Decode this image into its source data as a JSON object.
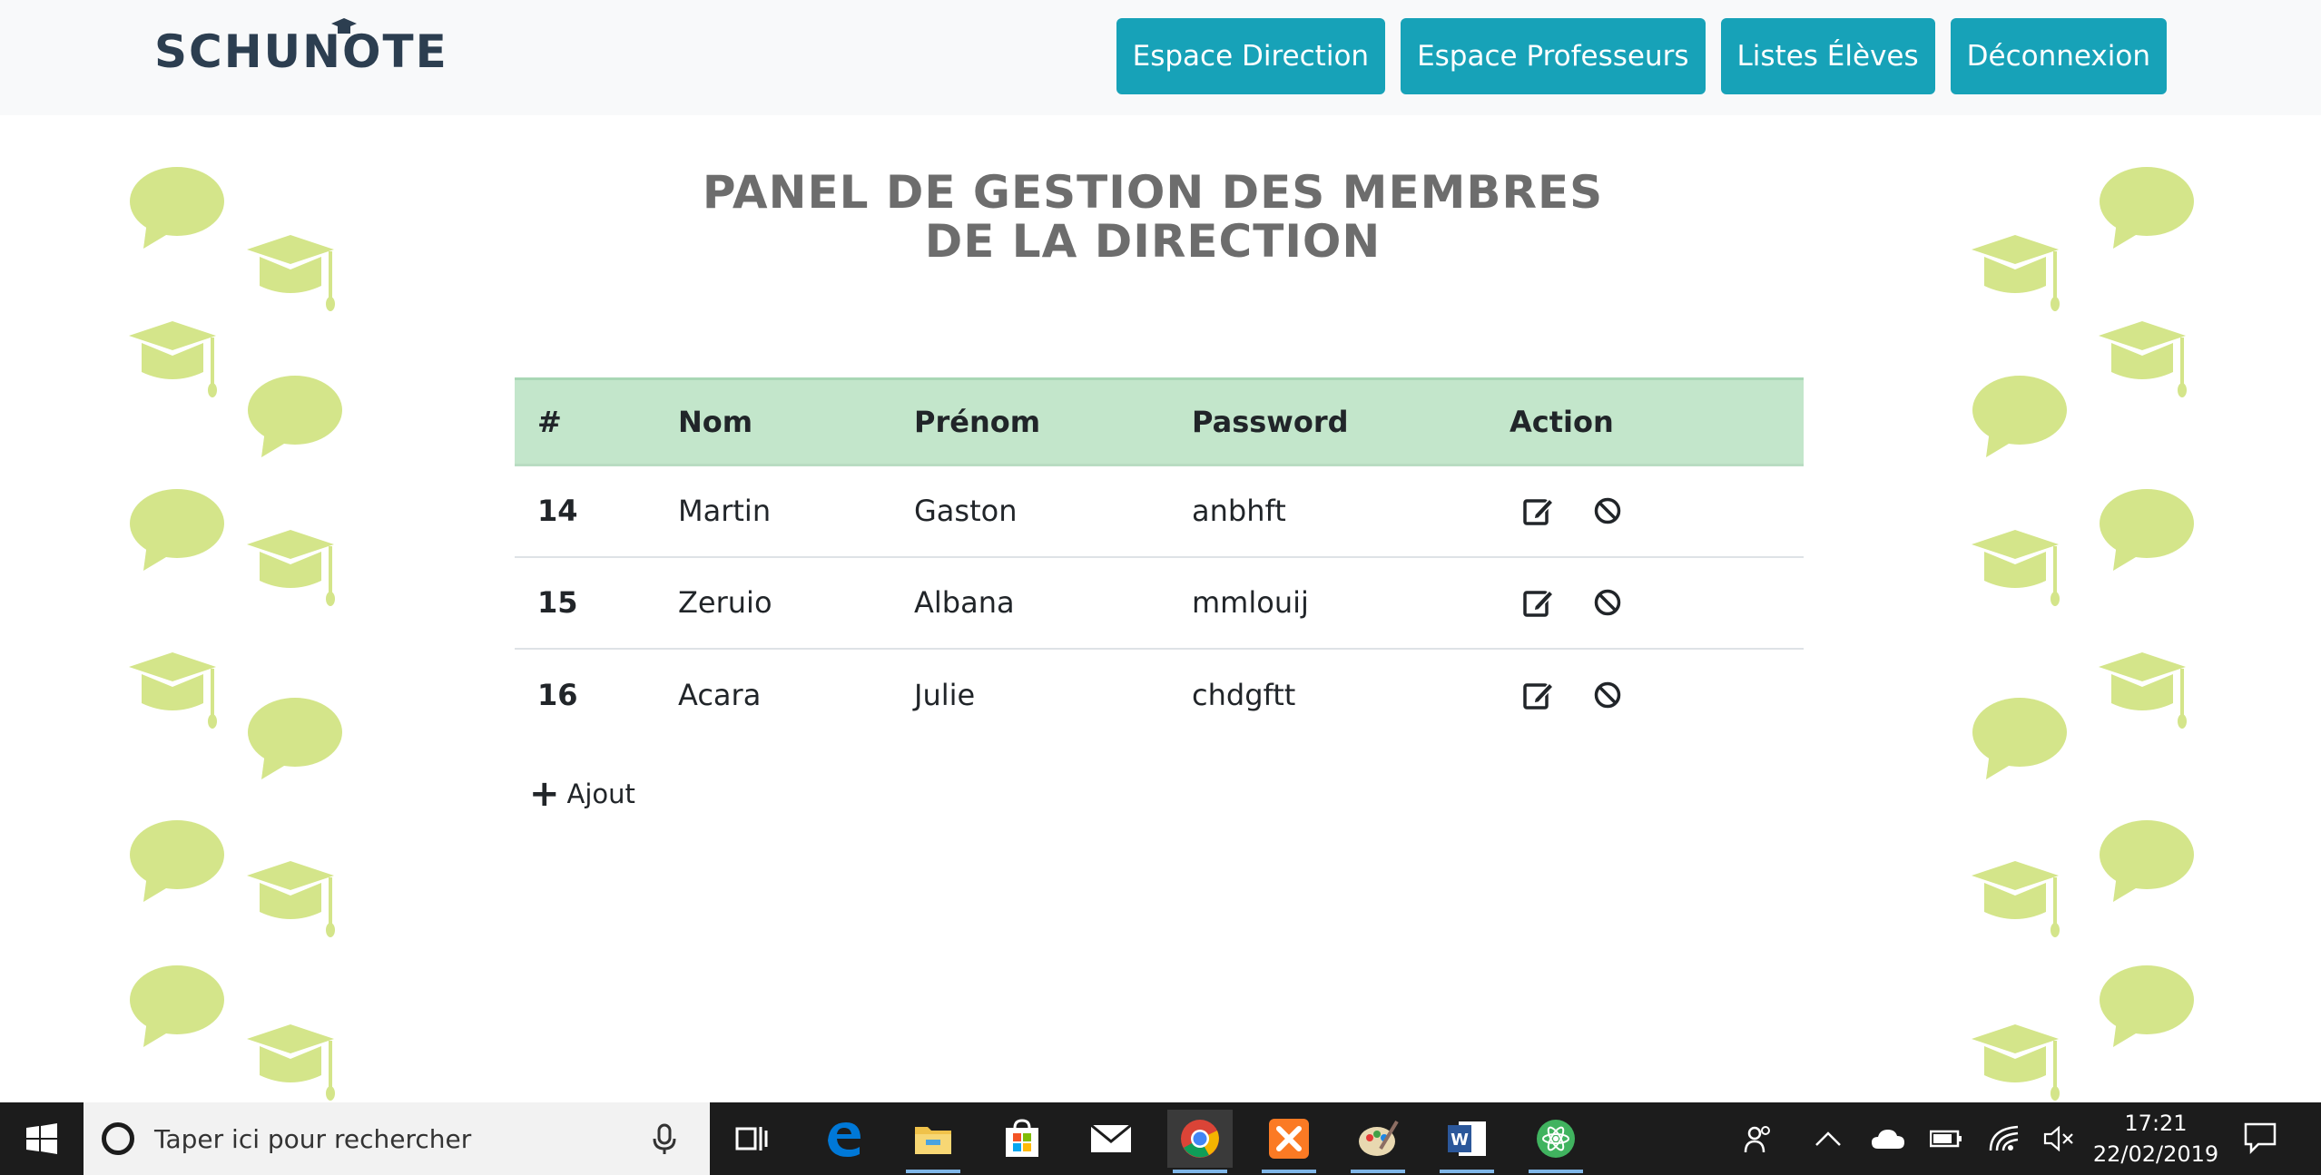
{
  "header": {
    "logo_text": "SCHUNOTE",
    "nav": [
      {
        "label": "Espace Direction"
      },
      {
        "label": "Espace Professeurs"
      },
      {
        "label": "Listes Élèves"
      },
      {
        "label": "Déconnexion"
      }
    ]
  },
  "page": {
    "title_line1": "PANEL DE GESTION DES MEMBRES",
    "title_line2": "DE LA DIRECTION"
  },
  "table": {
    "headers": [
      "#",
      "Nom",
      "Prénom",
      "Password",
      "Action"
    ],
    "rows": [
      {
        "id": "14",
        "nom": "Martin",
        "prenom": "Gaston",
        "password": "anbhft"
      },
      {
        "id": "15",
        "nom": "Zeruio",
        "prenom": "Albana",
        "password": "mmlouij"
      },
      {
        "id": "16",
        "nom": "Acara",
        "prenom": "Julie",
        "password": "chdgftt"
      }
    ],
    "action_icons": [
      "edit-icon",
      "ban-icon"
    ]
  },
  "add_label": "Ajout",
  "taskbar": {
    "search_placeholder": "Taper ici pour rechercher",
    "time": "17:21",
    "date": "22/02/2019",
    "apps": [
      "task-view",
      "edge",
      "file-explorer",
      "store",
      "mail",
      "chrome",
      "xampp",
      "paint",
      "word",
      "atom"
    ]
  },
  "colors": {
    "accent": "#17a2b8",
    "table_header": "#c3e6cb",
    "decoration": "#d4e58a",
    "title": "#6d6d6d",
    "logo": "#2c3e50"
  }
}
